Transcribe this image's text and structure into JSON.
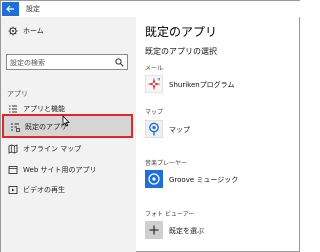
{
  "window": {
    "title": "設定"
  },
  "sidebar": {
    "home_label": "ホーム",
    "search_placeholder": "設定の検索",
    "section_label": "アプリ",
    "items": [
      {
        "label": "アプリと機能"
      },
      {
        "label": "既定のアプリ",
        "selected": true
      },
      {
        "label": "オフライン マップ"
      },
      {
        "label": "Web サイト用のアプリ"
      },
      {
        "label": "ビデオの再生"
      }
    ]
  },
  "main": {
    "title": "既定のアプリ",
    "subtitle": "既定のアプリの選択",
    "categories": [
      {
        "label": "メール",
        "app": "Shurikenプログラム",
        "icon": "shuriken-app-icon"
      },
      {
        "label": "マップ",
        "app": "マップ",
        "icon": "maps-app-icon"
      },
      {
        "label": "音楽プレーヤー",
        "app": "Groove ミュージック",
        "icon": "groove-music-icon"
      },
      {
        "label": "フォト ビューアー",
        "app": "既定を選ぶ",
        "icon": "plus-icon"
      }
    ]
  },
  "colors": {
    "accent": "#1e70d8",
    "selection_outline": "#e0262a",
    "sidebar_bg": "#f2f2f2",
    "selected_bg": "#d5d5d5"
  }
}
